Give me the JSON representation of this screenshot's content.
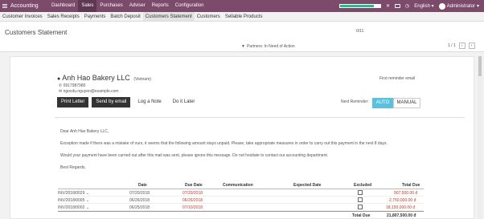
{
  "topbar": {
    "app_name": "Accounting",
    "menu": [
      "Dashboard",
      "Sales",
      "Purchases",
      "Adviser",
      "Reports",
      "Configuration"
    ],
    "active_menu": "Sales",
    "progress_fraction": 0.85,
    "language": "English",
    "user": "Administrator",
    "progress_color": "#1cbf8e",
    "bar_color": "#7c4a6b"
  },
  "subnav": [
    "Customer Invoices",
    "Sales Receipts",
    "Payments",
    "Batch Deposit",
    "Customers Statement",
    "Customers",
    "Sellable Products"
  ],
  "header": {
    "title": "Customers Statement",
    "counter": "0/11",
    "filter_label": "Partners: In Need of Action",
    "pager_text": "1 / 1"
  },
  "partner": {
    "name": "Anh Hao Bakery LLC",
    "country": "(Vietnam)",
    "phone": "0917987980",
    "email": "ngocdu.nguyen@example.com",
    "reminder_label": "First reminder email"
  },
  "actions": {
    "print_letter": "Print Letter",
    "send_email": "Send by email",
    "log_note": "Log a Note",
    "do_later": "Do it Later",
    "next_reminder_label": "Next Reminder:",
    "auto": "AUTO",
    "manual": "MANUAL"
  },
  "letter": {
    "greeting": "Dear Anh Hao Bakery LLC,",
    "body1": "Exception made if there was a mistake of ours, it seems that the following amount stays unpaid. Please, take appropriate measures in order to carry out this payment in the next 8 days.",
    "body2": "Would your payment have been carried out after this mail was sent, please ignore this message. Do not hesitate to contact our accounting department.",
    "regards": "Best Regards,"
  },
  "table": {
    "headers": {
      "date": "Date",
      "due_date": "Due Date",
      "communication": "Communication",
      "expected_date": "Expected Date",
      "excluded": "Excluded",
      "total_due": "Total Due"
    },
    "rows": [
      {
        "ref": "INV/2018/0029",
        "date": "07/20/2018",
        "due_date": "07/20/2018",
        "amount": "907,500.00 đ"
      },
      {
        "ref": "INV/2018/0005",
        "date": "06/26/2018",
        "due_date": "06/26/2018",
        "amount": "2,750,000.00 đ"
      },
      {
        "ref": "INV/2018/0002",
        "date": "06/25/2018",
        "due_date": "07/10/2018",
        "amount": "18,150,000.00 đ"
      }
    ],
    "total_label": "Total Due",
    "total_value": "21,807,500.00 đ"
  },
  "colors": {
    "accent_blue": "#5bc0de",
    "overdue_red": "#c0392b"
  }
}
